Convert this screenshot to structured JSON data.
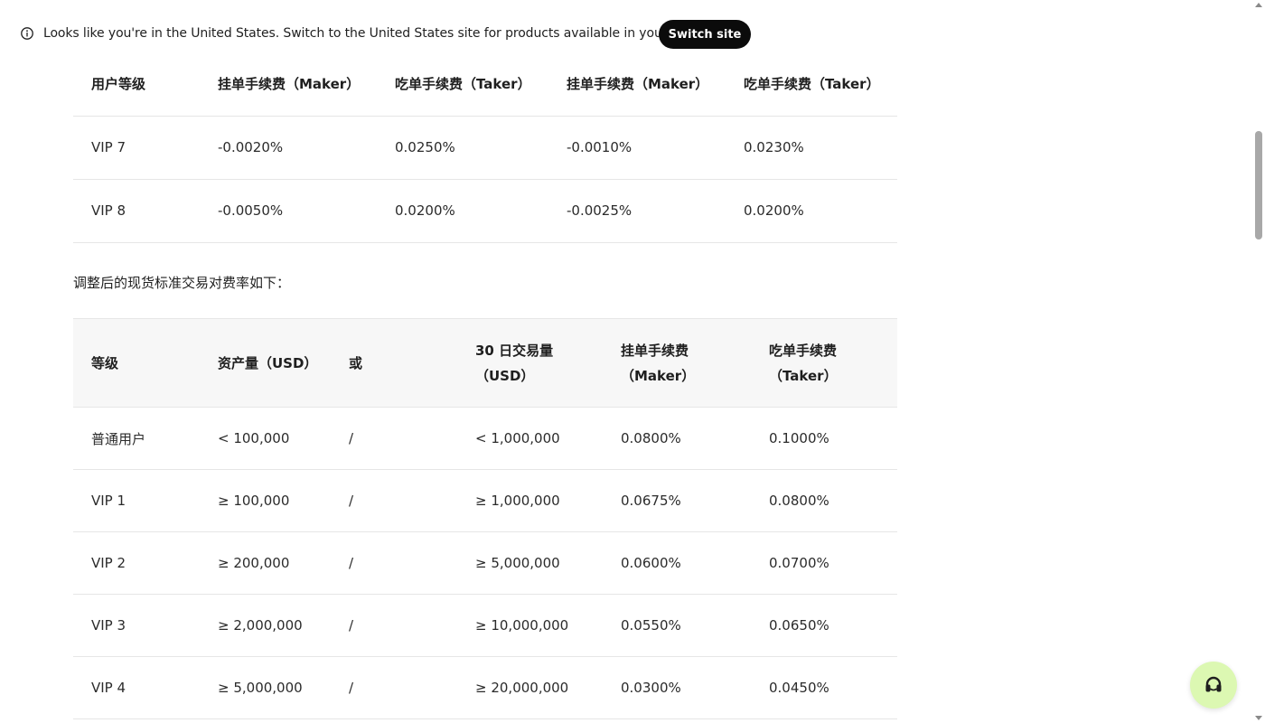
{
  "banner": {
    "icon": "info-icon",
    "message": "Looks like you're in the United States. Switch to the United States site for products available in your region.",
    "switch_label": "Switch site"
  },
  "vip_table": {
    "headers": [
      "用户等级",
      "挂单手续费（Maker）",
      "吃单手续费（Taker）",
      "挂单手续费（Maker）",
      "吃单手续费（Taker）"
    ],
    "rows": [
      [
        "VIP 7",
        "-0.0020%",
        "0.0250%",
        "-0.0010%",
        "0.0230%"
      ],
      [
        "VIP 8",
        "-0.0050%",
        "0.0200%",
        "-0.0025%",
        "0.0200%"
      ]
    ]
  },
  "intro_text": "调整后的现货标准交易对费率如下：",
  "spot_table": {
    "headers": [
      "等级",
      "资产量（USD）",
      "或",
      "30 日交易量（USD）",
      "挂单手续费（Maker）",
      "吃单手续费（Taker）"
    ],
    "rows": [
      [
        "普通用户",
        "< 100,000",
        "/",
        "< 1,000,000",
        "0.0800%",
        "0.1000%"
      ],
      [
        "VIP 1",
        "≥ 100,000",
        "/",
        "≥ 1,000,000",
        "0.0675%",
        "0.0800%"
      ],
      [
        "VIP 2",
        "≥ 200,000",
        "/",
        "≥ 5,000,000",
        "0.0600%",
        "0.0700%"
      ],
      [
        "VIP 3",
        "≥ 2,000,000",
        "/",
        "≥ 10,000,000",
        "0.0550%",
        "0.0650%"
      ],
      [
        "VIP 4",
        "≥ 5,000,000",
        "/",
        "≥ 20,000,000",
        "0.0300%",
        "0.0450%"
      ]
    ]
  },
  "support": {
    "icon": "headset-icon",
    "accent_color": "#dcf8b2"
  }
}
